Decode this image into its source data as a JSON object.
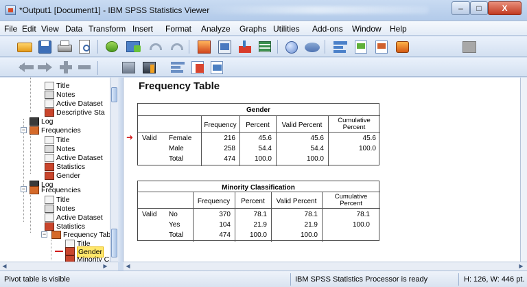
{
  "window": {
    "title": "*Output1 [Document1] - IBM SPSS Statistics Viewer",
    "minimize_glyph": "–",
    "maximize_glyph": "□",
    "close_glyph": "X"
  },
  "menu": [
    "File",
    "Edit",
    "View",
    "Data",
    "Transform",
    "Insert",
    "Format",
    "Analyze",
    "Graphs",
    "Utilities",
    "Add-ons",
    "Window",
    "Help"
  ],
  "toolbar": {
    "row1_icons": [
      "open-icon",
      "save-icon",
      "print-icon",
      "print-preview-icon",
      "export-icon",
      "dialog-recall-icon",
      "undo-icon",
      "redo-icon",
      "goto-data-icon",
      "goto-case-icon",
      "variables-icon",
      "select-last-output-icon",
      "designate-window-icon",
      "show-all-icon",
      "insert-heading-icon",
      "insert-title-icon",
      "insert-text-icon",
      "create-edit-script-icon",
      "run-script-icon"
    ],
    "row2_icons": [
      "promote-icon",
      "demote-icon",
      "expand-icon",
      "collapse-icon",
      "show-icon",
      "hide-icon",
      "insert-heading2-icon",
      "insert-title2-icon",
      "insert-text2-icon"
    ]
  },
  "outline": {
    "nodes": [
      {
        "label": "Title",
        "icon": "title-icon"
      },
      {
        "label": "Notes",
        "icon": "notes-icon"
      },
      {
        "label": "Active Dataset",
        "icon": "dataset-icon"
      },
      {
        "label": "Descriptive Sta",
        "icon": "table-icon"
      },
      {
        "label": "Log",
        "icon": "log-icon"
      },
      {
        "label": "Frequencies",
        "icon": "frequencies-icon"
      },
      {
        "label": "Title",
        "icon": "title-icon"
      },
      {
        "label": "Notes",
        "icon": "notes-icon"
      },
      {
        "label": "Active Dataset",
        "icon": "dataset-icon"
      },
      {
        "label": "Statistics",
        "icon": "table-icon"
      },
      {
        "label": "Gender",
        "icon": "table-icon"
      },
      {
        "label": "Log",
        "icon": "log-icon"
      },
      {
        "label": "Frequencies",
        "icon": "frequencies-icon"
      },
      {
        "label": "Title",
        "icon": "title-icon"
      },
      {
        "label": "Notes",
        "icon": "notes-icon"
      },
      {
        "label": "Active Dataset",
        "icon": "dataset-icon"
      },
      {
        "label": "Statistics",
        "icon": "table-icon"
      },
      {
        "label": "Frequency Tabl",
        "icon": "frequencies-icon"
      },
      {
        "label": "Title",
        "icon": "title-icon"
      },
      {
        "label": "Gender",
        "icon": "table-icon",
        "selected": true
      },
      {
        "label": "Minority Cl",
        "icon": "table-icon"
      }
    ]
  },
  "content": {
    "heading": "Frequency Table",
    "tables": [
      {
        "title": "Gender",
        "headers": [
          "Frequency",
          "Percent",
          "Valid Percent",
          "Cumulative Percent"
        ],
        "cumulative_line1": "Cumulative",
        "cumulative_line2": "Percent",
        "group_label": "Valid",
        "rows": [
          {
            "label": "Female",
            "values": [
              "216",
              "45.6",
              "45.6",
              "45.6"
            ]
          },
          {
            "label": "Male",
            "values": [
              "258",
              "54.4",
              "54.4",
              "100.0"
            ]
          },
          {
            "label": "Total",
            "values": [
              "474",
              "100.0",
              "100.0",
              ""
            ]
          }
        ]
      },
      {
        "title": "Minority Classification",
        "headers": [
          "Frequency",
          "Percent",
          "Valid Percent",
          "Cumulative Percent"
        ],
        "cumulative_line1": "Cumulative",
        "cumulative_line2": "Percent",
        "group_label": "Valid",
        "rows": [
          {
            "label": "No",
            "values": [
              "370",
              "78.1",
              "78.1",
              "78.1"
            ]
          },
          {
            "label": "Yes",
            "values": [
              "104",
              "21.9",
              "21.9",
              "100.0"
            ]
          },
          {
            "label": "Total",
            "values": [
              "474",
              "100.0",
              "100.0",
              ""
            ]
          }
        ]
      }
    ]
  },
  "status": {
    "left": "Pivot table is visible",
    "processor": "IBM SPSS Statistics Processor is ready",
    "dimensions": "H: 126, W: 446 pt."
  }
}
